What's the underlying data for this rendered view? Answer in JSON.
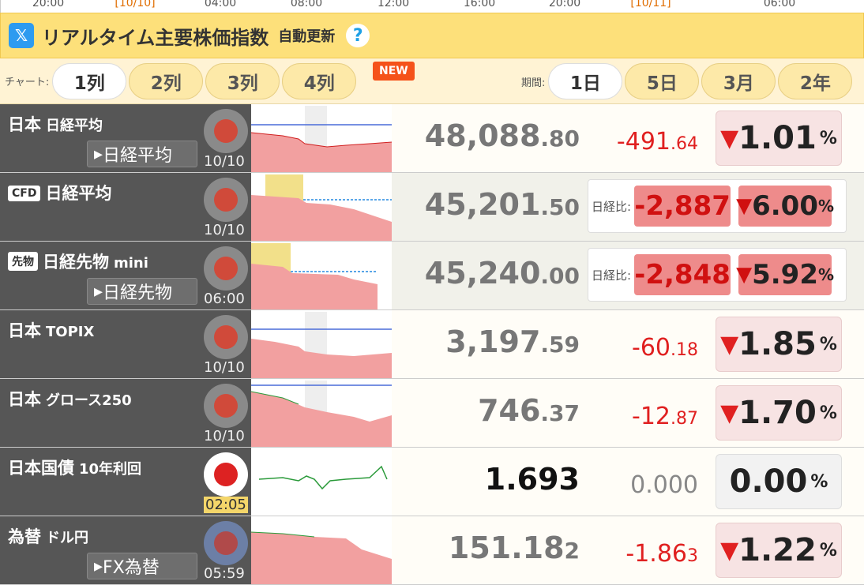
{
  "axis_labels": [
    "20:00",
    "[10/10]",
    "04:00",
    "08:00",
    "12:00",
    "16:00",
    "20:00",
    "[10/11]",
    "06:00"
  ],
  "header": {
    "title": "リアルタイム主要株価指数",
    "subtitle": "自動更新",
    "help": "?",
    "x_logo": "𝕏"
  },
  "controls": {
    "chart_label": "チャート:",
    "columns": [
      "1列",
      "2列",
      "3列",
      "4列"
    ],
    "new_badge": "NEW",
    "period_label": "期間:",
    "periods": [
      "1日",
      "5日",
      "3月",
      "2年"
    ]
  },
  "rows": [
    {
      "region": "日本",
      "name": "日経平均",
      "tag": "",
      "link": "日経平均",
      "time": "10/10",
      "price_int": "48,088",
      "price_dec": ".80",
      "chg_int": "-491",
      "chg_dec": ".64",
      "pct": "1.01",
      "arrow": "▼",
      "unit": "%"
    },
    {
      "region": "",
      "name": "日経平均",
      "tag": "CFD",
      "link": "",
      "time": "10/10",
      "price_int": "45,201",
      "price_dec": ".50",
      "cmp_label": "日経比:",
      "cmp_chg": "-2,887",
      "pct": "6.00",
      "arrow": "▼",
      "unit": "%"
    },
    {
      "region": "",
      "name": "日経先物",
      "extra": "mini",
      "tag": "先物",
      "link": "日経先物",
      "time": "06:00",
      "price_int": "45,240",
      "price_dec": ".00",
      "cmp_label": "日経比:",
      "cmp_chg": "-2,848",
      "pct": "5.92",
      "arrow": "▼",
      "unit": "%"
    },
    {
      "region": "日本",
      "name": "TOPIX",
      "tag": "",
      "link": "",
      "time": "10/10",
      "price_int": "3,197",
      "price_dec": ".59",
      "chg_int": "-60",
      "chg_dec": ".18",
      "pct": "1.85",
      "arrow": "▼",
      "unit": "%"
    },
    {
      "region": "日本",
      "name": "グロース250",
      "tag": "",
      "link": "",
      "time": "10/10",
      "price_int": "746",
      "price_dec": ".37",
      "chg_int": "-12",
      "chg_dec": ".87",
      "pct": "1.70",
      "arrow": "▼",
      "unit": "%"
    },
    {
      "region": "日本国債",
      "name": "10年利回",
      "tag": "",
      "link": "",
      "time": "02:05",
      "price_int": "1.693",
      "price_dec": "",
      "chg_int": "0.000",
      "chg_dec": "",
      "pct": "0.00",
      "arrow": "",
      "unit": "%"
    },
    {
      "region": "為替",
      "name": "ドル円",
      "tag": "",
      "link": "FX為替",
      "time": "05:59",
      "price_int": "151.18",
      "price_dec": "2",
      "chg_int": "-1.86",
      "chg_dec": "3",
      "pct": "1.22",
      "arrow": "▼",
      "unit": "%"
    }
  ]
}
